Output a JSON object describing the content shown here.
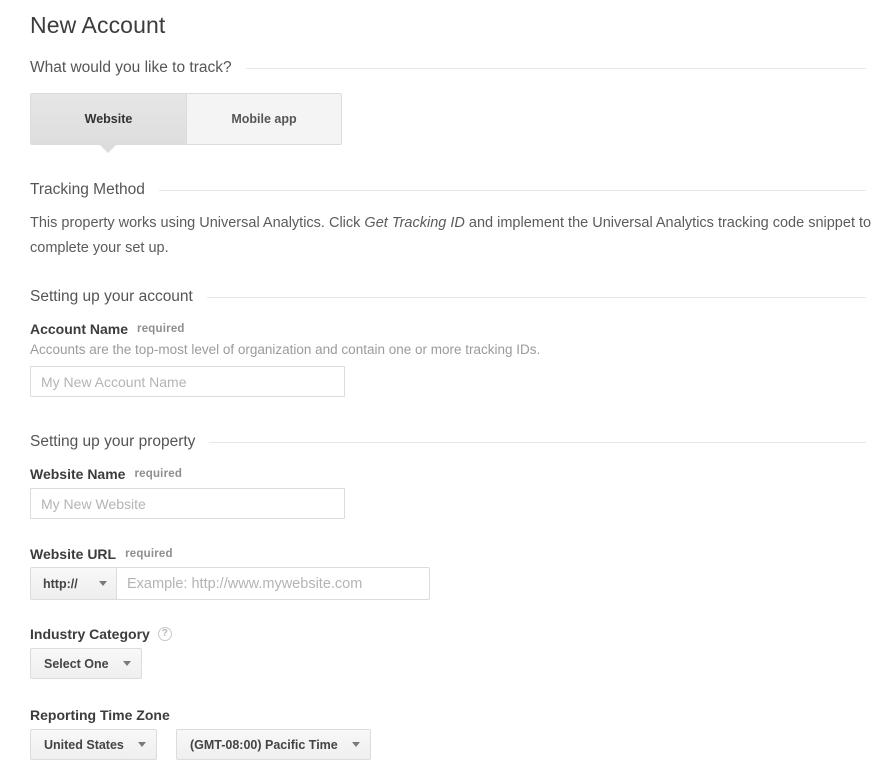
{
  "page": {
    "title": "New Account"
  },
  "track_section": {
    "heading": "What would you like to track?",
    "tabs": [
      {
        "label": "Website",
        "selected": true
      },
      {
        "label": "Mobile app",
        "selected": false
      }
    ]
  },
  "tracking_method": {
    "heading": "Tracking Method",
    "description_part1": "This property works using Universal Analytics. Click ",
    "description_emphasis": "Get Tracking ID",
    "description_part2": " and implement the Universal Analytics tracking code snippet to complete your set up."
  },
  "account_section": {
    "heading": "Setting up your account",
    "account_name": {
      "label": "Account Name",
      "required_text": "required",
      "hint": "Accounts are the top-most level of organization and contain one or more tracking IDs.",
      "value": "",
      "placeholder": "My New Account Name"
    }
  },
  "property_section": {
    "heading": "Setting up your property",
    "website_name": {
      "label": "Website Name",
      "required_text": "required",
      "value": "",
      "placeholder": "My New Website"
    },
    "website_url": {
      "label": "Website URL",
      "required_text": "required",
      "scheme_value": "http://",
      "value": "",
      "placeholder": "Example: http://www.mywebsite.com"
    },
    "industry_category": {
      "label": "Industry Category",
      "help_glyph": "?",
      "selected": "Select One"
    },
    "reporting_time_zone": {
      "label": "Reporting Time Zone",
      "country_selected": "United States",
      "zone_selected": "(GMT-08:00) Pacific Time"
    }
  },
  "colors": {
    "text_primary": "#3c3c3c",
    "text_secondary": "#5b5b5b",
    "text_muted": "#9b9b9b",
    "border": "#dcdcdc",
    "rule": "#e8e8e8"
  }
}
